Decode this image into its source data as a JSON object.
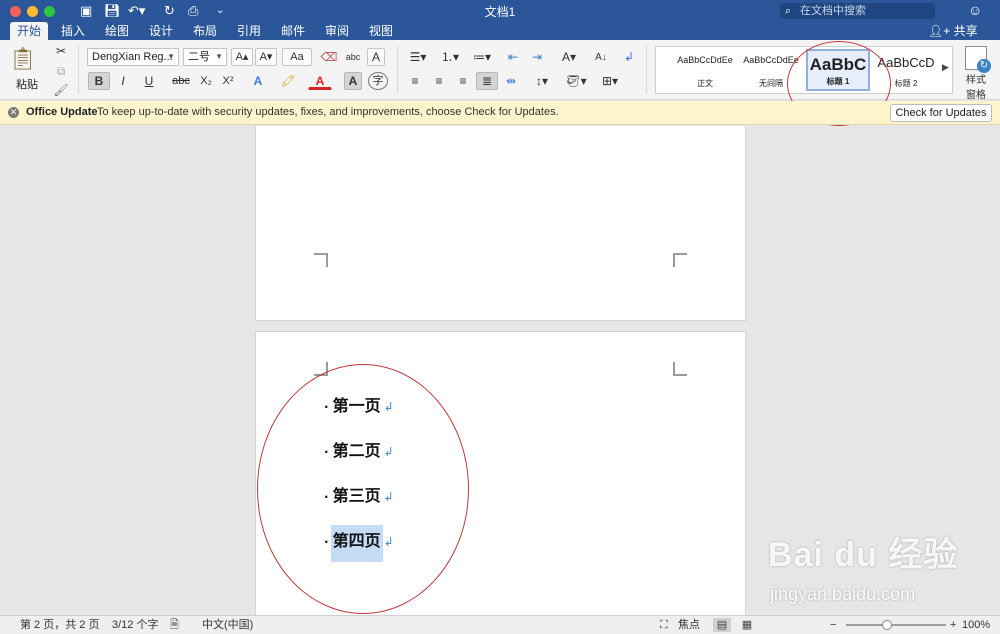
{
  "window": {
    "title": "文档1",
    "search_placeholder": "在文档中搜索",
    "share_label": "共享"
  },
  "tabs": [
    {
      "label": "开始",
      "active": true
    },
    {
      "label": "插入"
    },
    {
      "label": "绘图"
    },
    {
      "label": "设计"
    },
    {
      "label": "布局"
    },
    {
      "label": "引用"
    },
    {
      "label": "邮件"
    },
    {
      "label": "审阅"
    },
    {
      "label": "视图"
    }
  ],
  "ribbon": {
    "paste_label": "粘贴",
    "font_name": "DengXian Reg...",
    "font_size": "二号",
    "bold": "B",
    "italic": "I",
    "underline": "U",
    "strike": "abc",
    "subscript": "X₂",
    "superscript": "X²",
    "grow_font": "A▴",
    "shrink_font": "A▾",
    "change_case": "Aa",
    "phonetic": "abc",
    "char_border": "A",
    "enclose_char": "字",
    "styles": [
      {
        "preview": "AaBbCcDdEe",
        "name": "正文"
      },
      {
        "preview": "AaBbCcDdEe",
        "name": "无间隔"
      },
      {
        "preview": "AaBbC",
        "name": "标题 1",
        "selected": true
      },
      {
        "preview": "AaBbCcD",
        "name": "标题 2"
      }
    ],
    "styles_pane_label": "样式\n窗格"
  },
  "update_bar": {
    "title": "Office Update",
    "message": "To keep up-to-date with security updates, fixes, and improvements, choose Check for Updates.",
    "button_label": "Check for Updates"
  },
  "document": {
    "headings": [
      {
        "text": "第一页",
        "highlighted": false
      },
      {
        "text": "第二页",
        "highlighted": false
      },
      {
        "text": "第三页",
        "highlighted": false
      },
      {
        "text": "第四页",
        "highlighted": true
      }
    ],
    "paragraph_mark": "↲"
  },
  "status_bar": {
    "page_info": "第 2 页，共 2 页",
    "word_count": "3/12 个字",
    "language": "中文(中国)",
    "focus_label": "焦点",
    "zoom": "100%"
  },
  "watermark": {
    "logo_text": "Bai du 经验",
    "url": "jingyan.baidu.com"
  },
  "colors": {
    "title_band": "#2b579a",
    "ribbon_bg": "#f4f4f4",
    "update_bar_bg": "#fff4cc",
    "annotation_red": "#c0393b",
    "selection_blue": "#c5dcf5"
  }
}
